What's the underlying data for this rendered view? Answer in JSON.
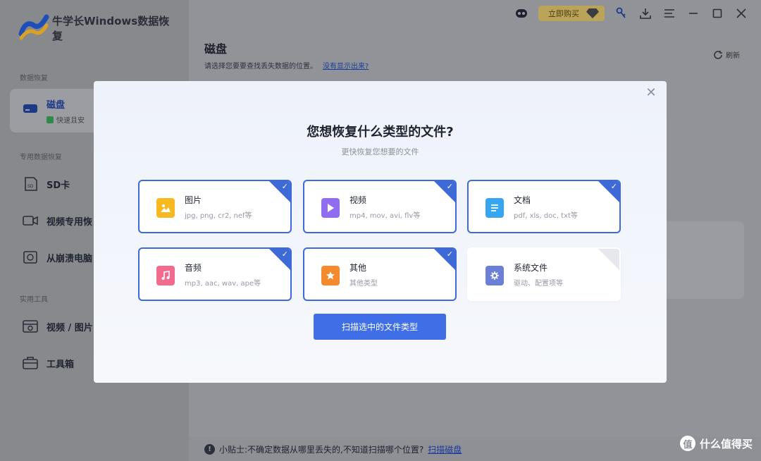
{
  "app": {
    "name": "牛学长Windows数据恢复",
    "buy_label": "立即购买"
  },
  "sidebar": {
    "sections": [
      {
        "title": "数据恢复"
      },
      {
        "title": "专用数据恢复"
      },
      {
        "title": "实用工具"
      }
    ],
    "items": [
      {
        "label": "磁盘",
        "sub": "快速且安",
        "icon": "disk-icon",
        "active": true
      },
      {
        "label": "SD卡",
        "icon": "sd-card-icon"
      },
      {
        "label": "视频专用恢",
        "icon": "video-camera-icon"
      },
      {
        "label": "从崩溃电脑",
        "icon": "crashed-pc-icon"
      },
      {
        "label": "视频 / 图片",
        "icon": "media-repair-icon"
      },
      {
        "label": "工具箱",
        "icon": "toolbox-icon"
      }
    ]
  },
  "main": {
    "title": "磁盘",
    "desc": "请选择您要要查找丢失数据的位置。",
    "desc_link": "没有显示出来?",
    "refresh_label": "刷新"
  },
  "modal": {
    "title": "您想恢复什么类型的文件?",
    "subtitle": "更快恢复您想要的文件",
    "cards": [
      {
        "title": "图片",
        "desc": "jpg, png, cr2, nef等",
        "icon": "image-icon",
        "color": "#f6b91f",
        "checked": true
      },
      {
        "title": "视频",
        "desc": "mp4, mov, avi, flv等",
        "icon": "video-icon",
        "color": "#8f6cf0",
        "checked": true
      },
      {
        "title": "文档",
        "desc": "pdf, xls, doc, txt等",
        "icon": "document-icon",
        "color": "#36a6f2",
        "checked": true
      },
      {
        "title": "音频",
        "desc": "mp3, aac, wav, ape等",
        "icon": "music-icon",
        "color": "#f26a8d",
        "checked": true
      },
      {
        "title": "其他",
        "desc": "其他类型",
        "icon": "star-file-icon",
        "color": "#f5892e",
        "checked": true
      },
      {
        "title": "系统文件",
        "desc": "驱动、配置项等",
        "icon": "gear-file-icon",
        "color": "#6b7fd6",
        "checked": false
      }
    ],
    "scan_label": "扫描选中的文件类型"
  },
  "tip": {
    "text": "小贴士:不确定数据从哪里丢失的,不知道扫描哪个位置?",
    "link": "扫描磁盘"
  },
  "watermark": {
    "glyph": "值",
    "text": "什么值得买"
  },
  "colors": {
    "accent": "#3f6ee6",
    "card_border": "#3e6ad8"
  }
}
